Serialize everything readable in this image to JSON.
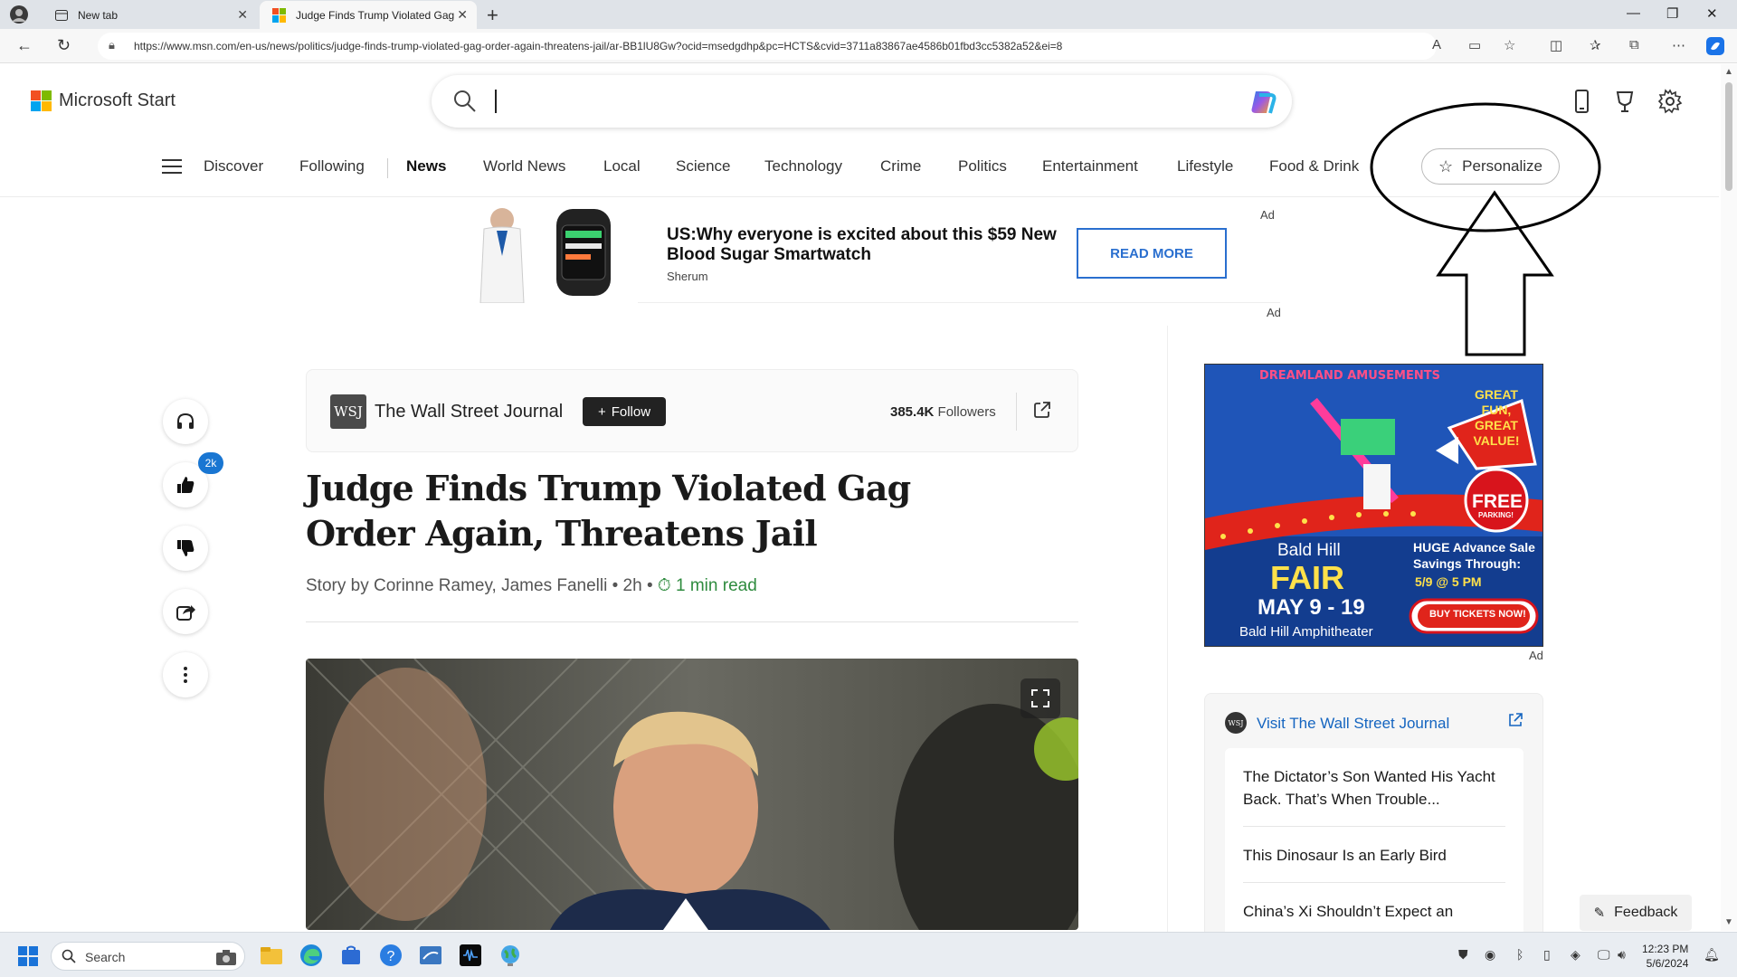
{
  "browser": {
    "tabs": [
      {
        "label": "New tab"
      },
      {
        "label": "Judge Finds Trump Violated Gag"
      }
    ],
    "url": "https://www.msn.com/en-us/news/politics/judge-finds-trump-violated-gag-order-again-threatens-jail/ar-BB1lU8Gw?ocid=msedgdhp&pc=HCTS&cvid=3711a83867ae4586b01fbd3cc5382a52&ei=8"
  },
  "header": {
    "logo_text": "Microsoft Start",
    "search_value": ""
  },
  "nav": {
    "items": [
      "Discover",
      "Following",
      "News",
      "World News",
      "Local",
      "Science",
      "Technology",
      "Crime",
      "Politics",
      "Entertainment",
      "Lifestyle",
      "Food & Drink"
    ],
    "active": "News",
    "personalize_label": "Personalize"
  },
  "top_ad": {
    "title": "US:Why everyone is excited about this $59 New Blood Sugar Smartwatch",
    "brand": "Sherum",
    "button": "READ MORE",
    "label": "Ad"
  },
  "rail": {
    "like_count": "2k"
  },
  "article": {
    "source": "The Wall Street Journal",
    "source_logo": "WSJ",
    "follow_label": "Follow",
    "followers_count": "385.4K",
    "followers_label": "Followers",
    "headline": "Judge Finds Trump Violated Gag Order Again, Threatens Jail",
    "byline": "Story by Corinne Ramey, James Fanelli • 2h •",
    "read_time": "1 min read"
  },
  "side_ad": {
    "brand_banner": "DREAMLAND AMUSEMENTS",
    "banner_tagline": "GREAT FUN, GREAT VALUE!",
    "free": "FREE",
    "parking": "PARKING!",
    "event_name": "Bald Hill",
    "event_fair": "FAIR",
    "dates": "MAY 9 - 19",
    "venue": "Bald Hill Amphitheater",
    "advance_text": "HUGE Advance Sale Savings Through:",
    "advance_date": "5/9 @ 5 PM",
    "cta": "BUY TICKETS NOW!",
    "label": "Ad"
  },
  "related": {
    "title": "Visit The Wall Street Journal",
    "items": [
      "The Dictator’s Son Wanted His Yacht Back. That’s When Trouble...",
      "This Dinosaur Is an Early Bird",
      "China’s Xi Shouldn’t Expect an"
    ]
  },
  "feedback_label": "Feedback",
  "taskbar": {
    "search_label": "Search",
    "time": "12:23 PM",
    "date": "5/6/2024"
  },
  "colors": {
    "accent": "#1976d2",
    "read_time": "#2e8b3e",
    "link": "#1565c0"
  }
}
